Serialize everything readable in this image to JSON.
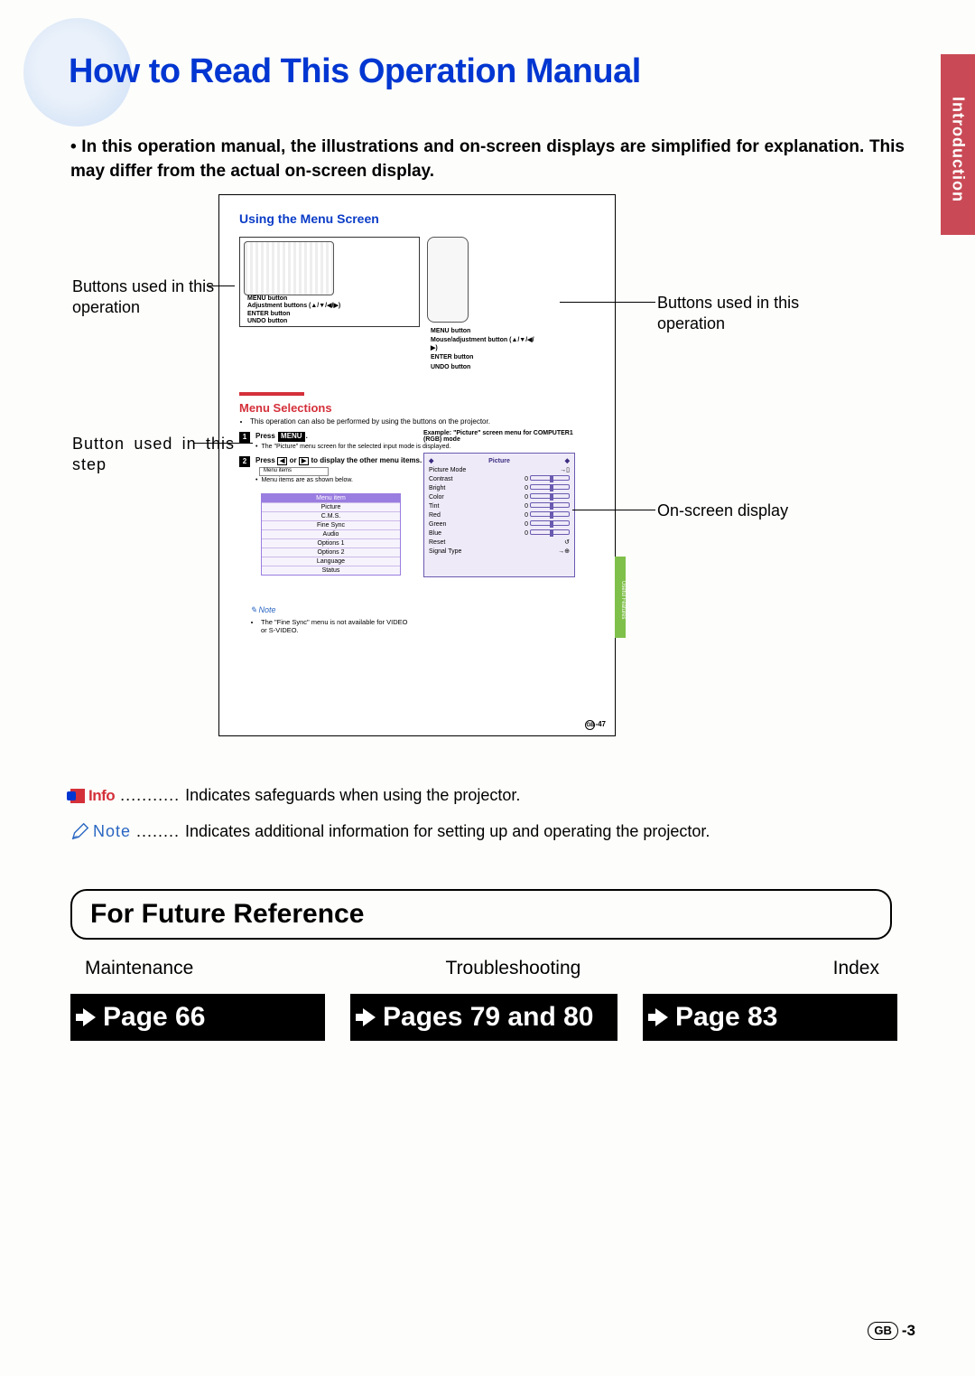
{
  "sideTab": "Introduction",
  "title": "How to Read This Operation Manual",
  "intro": "• In this operation manual, the illustrations and on-screen displays are simplified for explanation. This may differ from the actual on-screen display.",
  "diagram": {
    "usingMenu": "Using the Menu Screen",
    "topLabels": {
      "menuBtn": "MENU button",
      "adjBtns": "Adjustment buttons (▲/▼/◀/▶)",
      "enterBtn": "ENTER button",
      "undoBtn": "UNDO button",
      "mouseAdj": "Mouse/adjustment button (▲/▼/◀/▶)"
    },
    "menuSelections": "Menu Selections",
    "menuSelNote": "This operation can also be performed by using the buttons on the projector.",
    "step1": {
      "num": "1",
      "text": "Press ",
      "btn": "MENU",
      "after": "."
    },
    "step1Sub": "The \"Picture\" menu screen for the selected input mode is displayed.",
    "step2": {
      "num": "2",
      "pre": "Press ",
      "or": " or ",
      "post": " to display the other menu items."
    },
    "step2Sub1": "Menu items",
    "step2Sub2": "Menu items are as shown below.",
    "menuItems": {
      "header": "Menu item",
      "rows": [
        "Picture",
        "C.M.S.",
        "Fine Sync",
        "Audio",
        "Options 1",
        "Options 2",
        "Language",
        "Status"
      ]
    },
    "noteLabel": "Note",
    "noteBody": "The \"Fine Sync\" menu is not available for VIDEO or S-VIDEO.",
    "example": "Example: \"Picture\" screen menu for COMPUTER1 (RGB) mode",
    "osd": {
      "title": "Picture",
      "rows": [
        {
          "label": "Picture Mode",
          "val": "→▯"
        },
        {
          "label": "Contrast",
          "val": "0"
        },
        {
          "label": "Bright",
          "val": "0"
        },
        {
          "label": "Color",
          "val": "0"
        },
        {
          "label": "Tint",
          "val": "0"
        },
        {
          "label": "Red",
          "val": "0"
        },
        {
          "label": "Green",
          "val": "0"
        },
        {
          "label": "Blue",
          "val": "0"
        },
        {
          "label": "Reset",
          "val": ""
        },
        {
          "label": "Signal Type",
          "val": "→⊕"
        }
      ]
    },
    "miniTab": "Useful Features",
    "innerPage": "-47",
    "innerPageGB": "GB"
  },
  "callouts": {
    "c1": "Buttons used in this operation",
    "c2": "Button used in this step",
    "c3": "Buttons used in this operation",
    "c4": "On-screen display"
  },
  "legend": {
    "info": "Info",
    "infoDesc": "Indicates safeguards when using the projector.",
    "note": "Note",
    "noteDesc": "Indicates additional information for setting up and operating the projector."
  },
  "futureRef": "For Future Reference",
  "refCols": {
    "c1": "Maintenance",
    "c2": "Troubleshooting",
    "c3": "Index"
  },
  "pageBtns": {
    "p1": "Page 66",
    "p2": "Pages 79 and 80",
    "p3": "Page 83"
  },
  "footer": {
    "gb": "GB",
    "pg": "-3"
  }
}
